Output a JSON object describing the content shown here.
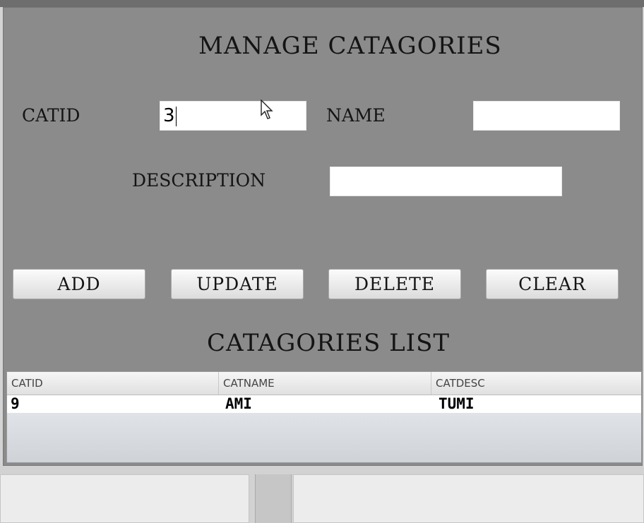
{
  "form": {
    "title": "MANAGE CATAGORIES",
    "catid_label": "CATID",
    "catid_value": "3",
    "name_label": "NAME",
    "name_value": "",
    "description_label": "DESCRIPTION",
    "description_value": ""
  },
  "buttons": {
    "add": "ADD",
    "update": "UPDATE",
    "delete": "DELETE",
    "clear": "CLEAR"
  },
  "list": {
    "title": "CATAGORIES LIST",
    "columns": [
      "CATID",
      "CATNAME",
      "CATDESC"
    ],
    "rows": [
      [
        "9",
        "AMI",
        "TUMI"
      ]
    ]
  },
  "colors": {
    "panel_background": "#8b8b8b",
    "field_background": "#ffffff",
    "text": "#141414"
  },
  "icons": {
    "cursor": "mouse-pointer-icon"
  }
}
